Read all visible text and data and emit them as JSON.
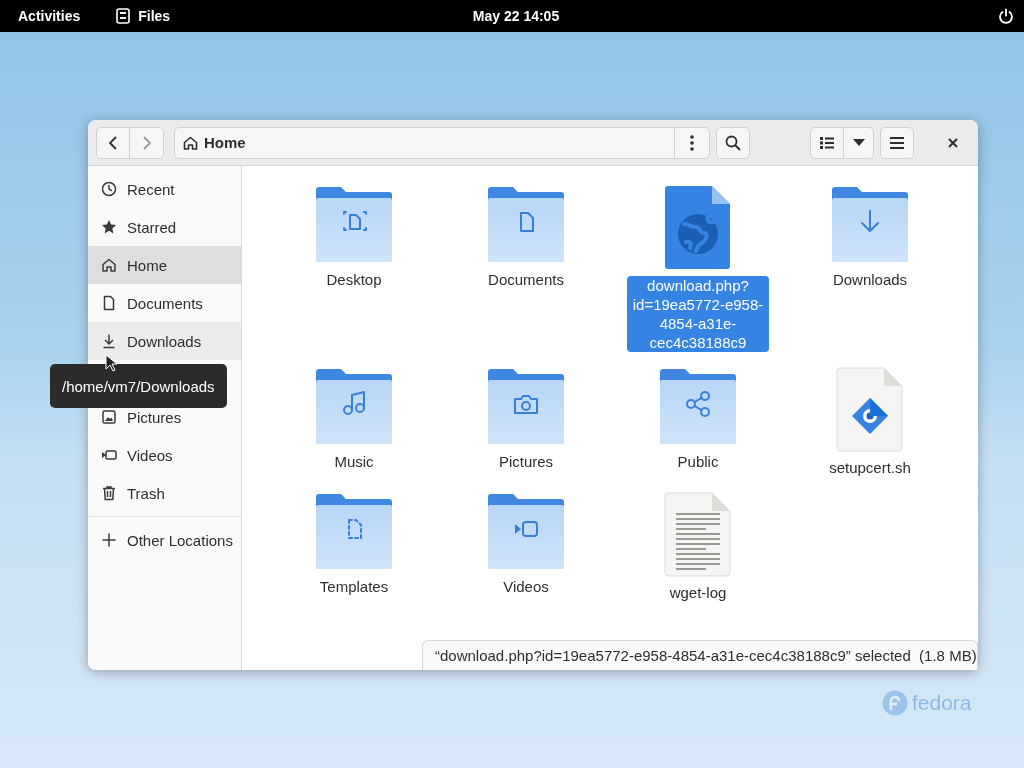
{
  "top_bar": {
    "activities": "Activities",
    "app": "Files",
    "clock": "May 22  14:05"
  },
  "window": {
    "location": "Home"
  },
  "sidebar": {
    "items": [
      {
        "kind": "recent",
        "label": "Recent",
        "selected": false,
        "hovered": false
      },
      {
        "kind": "starred",
        "label": "Starred",
        "selected": false,
        "hovered": false
      },
      {
        "kind": "home",
        "label": "Home",
        "selected": true,
        "hovered": false
      },
      {
        "kind": "documents",
        "label": "Documents",
        "selected": false,
        "hovered": false
      },
      {
        "kind": "downloads",
        "label": "Downloads",
        "selected": false,
        "hovered": true
      },
      {
        "kind": "hidden"
      },
      {
        "kind": "pictures",
        "label": "Pictures",
        "selected": false,
        "hovered": false
      },
      {
        "kind": "videos",
        "label": "Videos",
        "selected": false,
        "hovered": false
      },
      {
        "kind": "trash",
        "label": "Trash",
        "selected": false,
        "hovered": false
      }
    ],
    "other": {
      "label": "Other Locations"
    }
  },
  "tooltip": {
    "text": "/home/vm7/Downloads"
  },
  "files": [
    {
      "name": "Desktop",
      "kind": "folder-desktop",
      "selected": false
    },
    {
      "name": "Documents",
      "kind": "folder-documents",
      "selected": false
    },
    {
      "name": "download.php?\nid=19ea5772-e958-\n4854-a31e-\ncec4c38188c9",
      "kind": "web",
      "selected": true
    },
    {
      "name": "Downloads",
      "kind": "folder-downloads",
      "selected": false
    },
    {
      "name": "Music",
      "kind": "folder-music",
      "selected": false
    },
    {
      "name": "Pictures",
      "kind": "folder-pictures",
      "selected": false
    },
    {
      "name": "Public",
      "kind": "folder-public",
      "selected": false
    },
    {
      "name": "setupcert.sh",
      "kind": "script",
      "selected": false
    },
    {
      "name": "Templates",
      "kind": "folder-templates",
      "selected": false
    },
    {
      "name": "Videos",
      "kind": "folder-videos",
      "selected": false
    },
    {
      "name": "wget-log",
      "kind": "text",
      "selected": false
    }
  ],
  "status": "“download.php?id=19ea5772-e958-4854-a31e-cec4c38188c9” selected  (1.8 MB)",
  "brand": "fedora"
}
